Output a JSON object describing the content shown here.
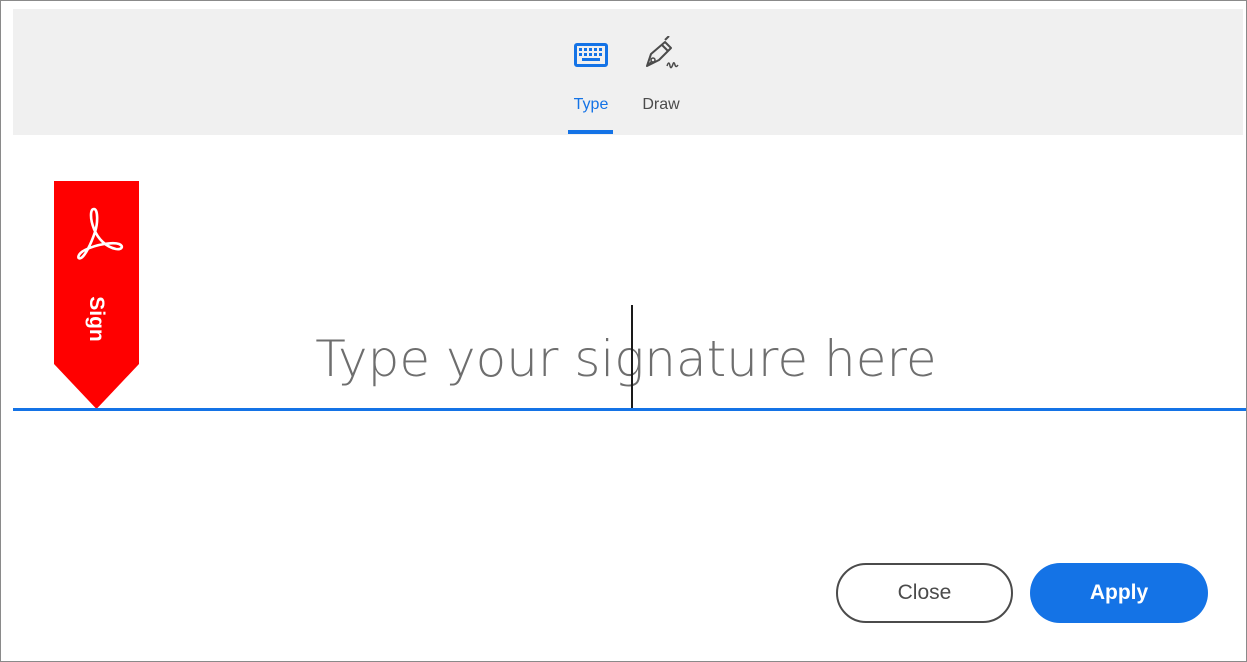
{
  "tabs": [
    {
      "label": "Type",
      "icon": "keyboard-icon",
      "selected": true
    },
    {
      "label": "Draw",
      "icon": "pen-signature-icon",
      "selected": false
    }
  ],
  "badge": {
    "label": "Sign",
    "icon": "acrobat-logo-icon",
    "color": "#ff0000"
  },
  "signature": {
    "placeholder": "Type your signature here",
    "value": ""
  },
  "buttons": {
    "close_label": "Close",
    "apply_label": "Apply"
  },
  "colors": {
    "accent": "#1473e6",
    "badge": "#ff0000"
  }
}
